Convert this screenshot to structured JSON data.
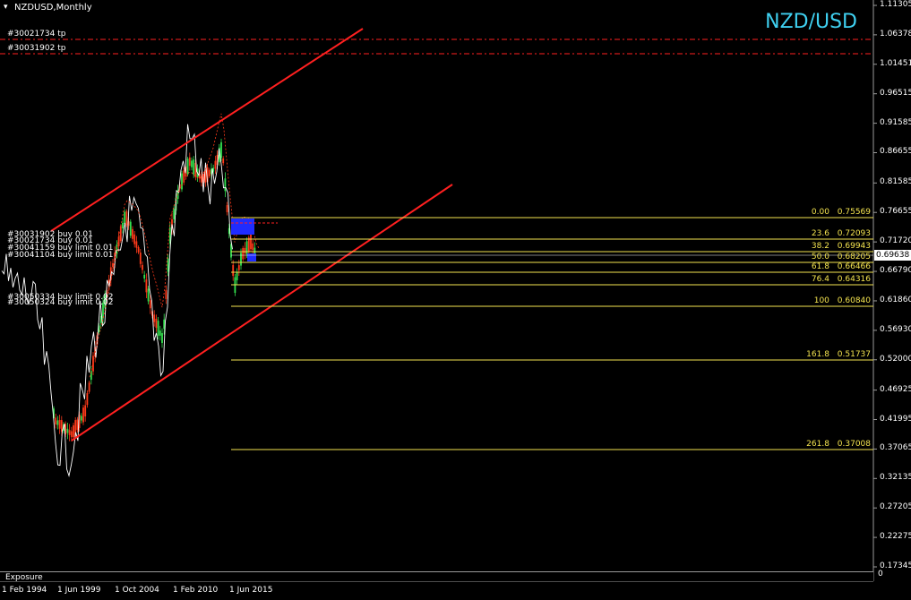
{
  "header": {
    "symbol_title": "NZDUSD,Monthly",
    "pair_label": "NZD/USD"
  },
  "price_axis": {
    "ticks": [
      "1.11305",
      "1.06378",
      "1.01451",
      "0.96515",
      "0.91585",
      "0.86655",
      "0.81585",
      "0.76655",
      "0.71720",
      "0.66790",
      "0.61860",
      "0.56930",
      "0.52000",
      "0.46925",
      "0.41995",
      "0.37065",
      "0.32135",
      "0.27205",
      "0.22275",
      "0.17345"
    ],
    "current_price": "0.69638"
  },
  "time_axis": {
    "ticks": [
      "1 Feb 1994",
      "1 Jun 1999",
      "1 Oct 2004",
      "1 Feb 2010",
      "1 Jun 2015"
    ]
  },
  "tp_lines": [
    {
      "label": "#30021734 tp"
    },
    {
      "label": "#30031902 tp"
    }
  ],
  "order_labels": {
    "upper": [
      "#30031902 buy 0.01",
      "#30021734 buy 0.01",
      "#30041159 buy limit 0.01",
      "#30041104 buy limit 0.01"
    ],
    "lower": [
      "#30050334 buy limit 0.02",
      "#30050324 buy limit 0.02"
    ]
  },
  "fibonacci": [
    {
      "level": "0.00",
      "price": "0.75569"
    },
    {
      "level": "23.6",
      "price": "0.72093"
    },
    {
      "level": "38.2",
      "price": "0.69943"
    },
    {
      "level": "50.0",
      "price": "0.68205"
    },
    {
      "level": "61.8",
      "price": "0.66466"
    },
    {
      "level": "76.4",
      "price": "0.64316"
    },
    {
      "level": "100",
      "price": "0.60840"
    },
    {
      "level": "161.8",
      "price": "0.51737"
    },
    {
      "level": "261.8",
      "price": "0.37008"
    }
  ],
  "bottom_panel": {
    "exposure_label": "Exposure",
    "scroll_marker": "0"
  },
  "colors": {
    "background": "#000000",
    "channel": "#ff2020",
    "fib": "#f3e34f",
    "tp_line": "#ff2020",
    "bull_candle": "#34e34f",
    "bear_candle": "#ff3a1a",
    "overlay_line": "#ffffff",
    "pair_label": "#3fd0f0",
    "order_zone": "#1f2cff"
  }
}
